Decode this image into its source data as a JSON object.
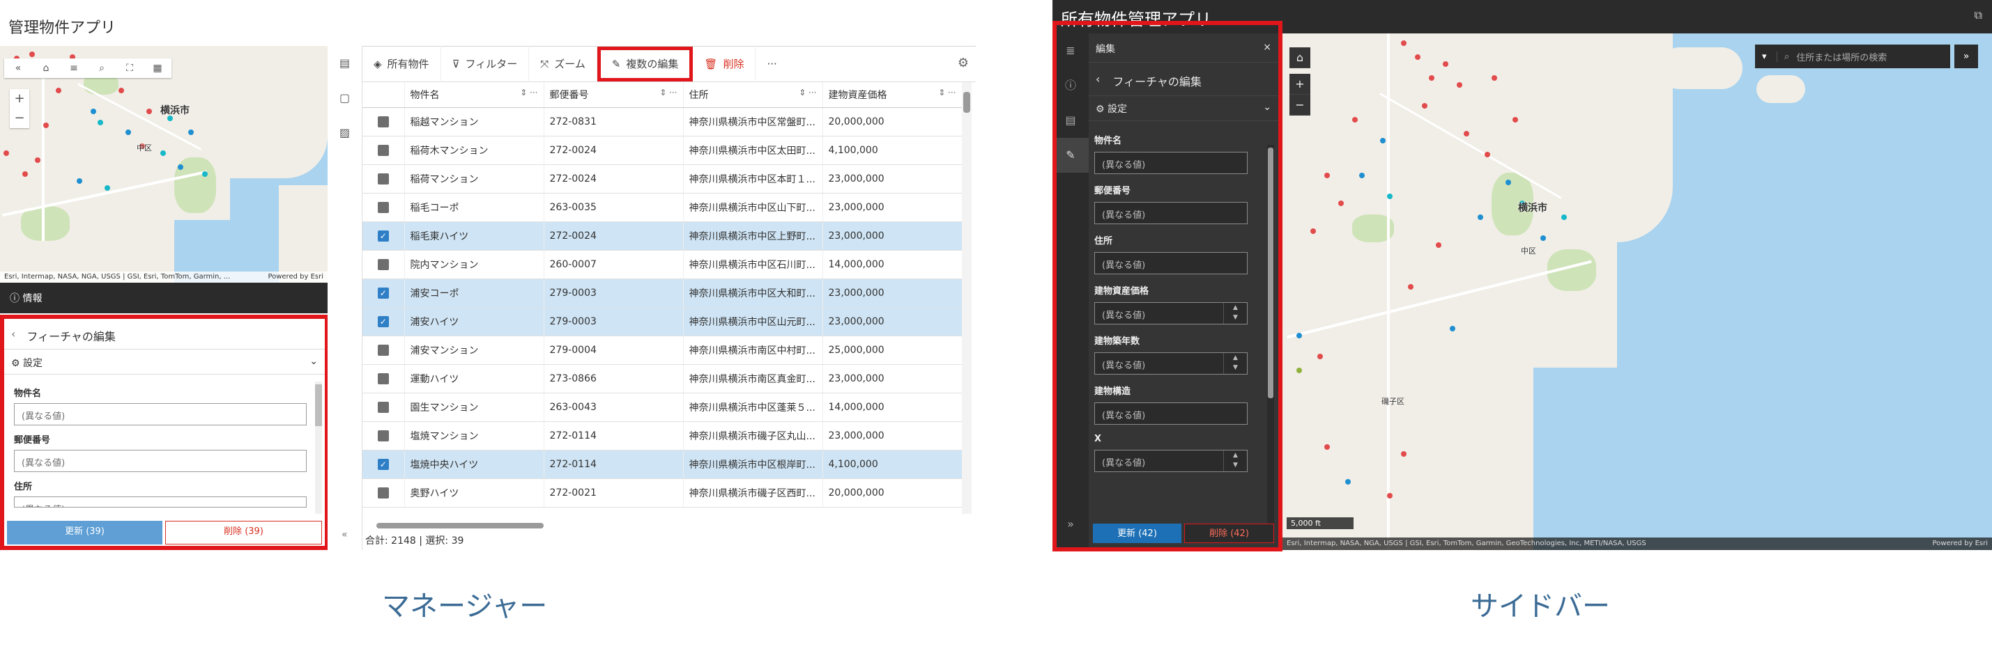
{
  "manager": {
    "app_title": "管理物件アプリ",
    "map": {
      "attribution": "Esri, Intermap, NASA, NGA, USGS | GSI, Esri, TomTom, Garmin, ...",
      "powered_by": "Powered by Esri",
      "labels": {
        "city": "横浜市",
        "ward": "中区"
      },
      "toolbar_icons": [
        "collapse-icon",
        "home-icon",
        "list-icon",
        "search-icon",
        "fullscreen-icon",
        "basemap-icon"
      ],
      "zoom_in": "+",
      "zoom_out": "−"
    },
    "info_bar": {
      "label": "情報"
    },
    "edit_panel": {
      "back_icon": "‹",
      "title": "フィーチャの編集",
      "settings_label": "設定",
      "fields": [
        {
          "label": "物件名",
          "placeholder": "(異なる値)"
        },
        {
          "label": "郵便番号",
          "placeholder": "(異なる値)"
        },
        {
          "label": "住所",
          "placeholder": "(異なる値)"
        }
      ],
      "update_button": "更新 (39)",
      "delete_button": "削除 (39)"
    },
    "table_toolbar": {
      "layer_label": "所有物件",
      "filter_label": "フィルター",
      "zoom_label": "ズーム",
      "multi_edit_label": "複数の編集",
      "delete_label": "削除",
      "more_label": "···"
    },
    "table": {
      "columns": [
        "物件名",
        "郵便番号",
        "住所",
        "建物資産価格"
      ],
      "rows": [
        {
          "selected": false,
          "name": "稲越マンション",
          "zip": "272-0831",
          "address": "神奈川県横浜市中区常盤町...",
          "price": "20,000,000"
        },
        {
          "selected": false,
          "name": "稲荷木マンション",
          "zip": "272-0024",
          "address": "神奈川県横浜市中区太田町...",
          "price": "4,100,000"
        },
        {
          "selected": false,
          "name": "稲荷マンション",
          "zip": "272-0024",
          "address": "神奈川県横浜市中区本町１...",
          "price": "23,000,000"
        },
        {
          "selected": false,
          "name": "稲毛コーポ",
          "zip": "263-0035",
          "address": "神奈川県横浜市中区山下町...",
          "price": "23,000,000"
        },
        {
          "selected": true,
          "name": "稲毛東ハイツ",
          "zip": "272-0024",
          "address": "神奈川県横浜市中区上野町...",
          "price": "23,000,000"
        },
        {
          "selected": false,
          "name": "院内マンション",
          "zip": "260-0007",
          "address": "神奈川県横浜市中区石川町...",
          "price": "14,000,000"
        },
        {
          "selected": true,
          "name": "浦安コーポ",
          "zip": "279-0003",
          "address": "神奈川県横浜市中区大和町...",
          "price": "23,000,000"
        },
        {
          "selected": true,
          "name": "浦安ハイツ",
          "zip": "279-0003",
          "address": "神奈川県横浜市中区山元町...",
          "price": "23,000,000"
        },
        {
          "selected": false,
          "name": "浦安マンション",
          "zip": "279-0004",
          "address": "神奈川県横浜市南区中村町...",
          "price": "25,000,000"
        },
        {
          "selected": false,
          "name": "運動ハイツ",
          "zip": "273-0866",
          "address": "神奈川県横浜市南区真金町...",
          "price": "23,000,000"
        },
        {
          "selected": false,
          "name": "園生マンション",
          "zip": "263-0043",
          "address": "神奈川県横浜市中区蓬莱５...",
          "price": "14,000,000"
        },
        {
          "selected": false,
          "name": "塩焼マンション",
          "zip": "272-0114",
          "address": "神奈川県横浜市磯子区丸山...",
          "price": "23,000,000"
        },
        {
          "selected": true,
          "name": "塩焼中央ハイツ",
          "zip": "272-0114",
          "address": "神奈川県横浜市中区根岸町...",
          "price": "4,100,000"
        },
        {
          "selected": false,
          "name": "奥野ハイツ",
          "zip": "272-0021",
          "address": "神奈川県横浜市磯子区西町...",
          "price": "20,000,000"
        }
      ],
      "footer": "合計: 2148 | 選択: 39"
    },
    "caption": "マネージャー"
  },
  "sidebar": {
    "app_title": "所有物件管理アプリ",
    "rail_icons": [
      "layers-icon",
      "info-icon",
      "bookmark-icon",
      "edit-icon"
    ],
    "edit_panel": {
      "header": "編集",
      "close": "×",
      "title": "フィーチャの編集",
      "settings_label": "設定",
      "fields": [
        {
          "label": "物件名",
          "placeholder": "(異なる値)",
          "spin": false
        },
        {
          "label": "郵便番号",
          "placeholder": "(異なる値)",
          "spin": false
        },
        {
          "label": "住所",
          "placeholder": "(異なる値)",
          "spin": false
        },
        {
          "label": "建物資産価格",
          "placeholder": "(異なる値)",
          "spin": true
        },
        {
          "label": "建物築年数",
          "placeholder": "(異なる値)",
          "spin": true
        },
        {
          "label": "建物構造",
          "placeholder": "(異なる値)",
          "spin": false
        },
        {
          "label": "X",
          "placeholder": "(異なる値)",
          "spin": true
        }
      ],
      "update_button": "更新 (42)",
      "delete_button": "削除 (42)",
      "expand": "»"
    },
    "map": {
      "search_placeholder": "住所または場所の検索",
      "expand": "»",
      "labels": {
        "city": "横浜市",
        "ward": "中区",
        "ward2": "磯子区"
      },
      "scale": "5,000 ft",
      "attribution": "Esri, Intermap, NASA, NGA, USGS | GSI, Esri, TomTom, Garmin, GeoTechnologies, Inc, METI/NASA, USGS",
      "powered_by": "Powered by Esri"
    },
    "caption": "サイドバー"
  }
}
